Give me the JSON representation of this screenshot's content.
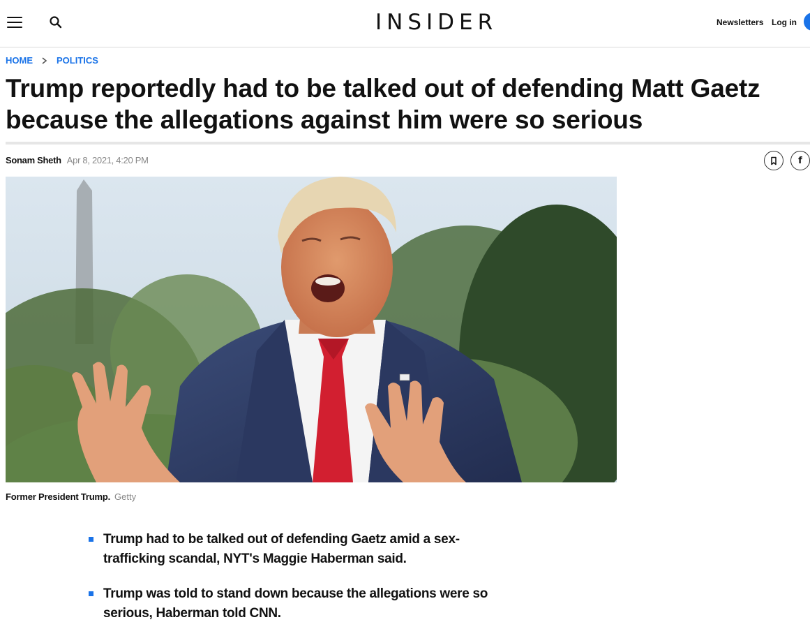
{
  "header": {
    "logo": "INSIDER",
    "newsletters_label": "Newsletters",
    "login_label": "Log in",
    "accent_color": "#1a73e8"
  },
  "breadcrumb": {
    "items": [
      "HOME",
      "POLITICS"
    ]
  },
  "article": {
    "headline": "Trump reportedly had to be talked out of defending Matt Gaetz because the allegations against him were so serious",
    "author": "Sonam Sheth",
    "date": "Apr 8, 2021, 4:20 PM",
    "image_caption": "Former President Trump.",
    "image_credit": "Getty",
    "summary": [
      "Trump had to be talked out of defending Gaetz amid a sex-trafficking scandal, NYT's Maggie Haberman said.",
      "Trump was told to stand down because the allegations were so serious, Haberman told CNN."
    ]
  },
  "icons": {
    "menu": "hamburger-icon",
    "search": "search-icon",
    "breadcrumb_separator": "chevron-right-icon",
    "save": "bookmark-icon",
    "share": "facebook-icon"
  }
}
